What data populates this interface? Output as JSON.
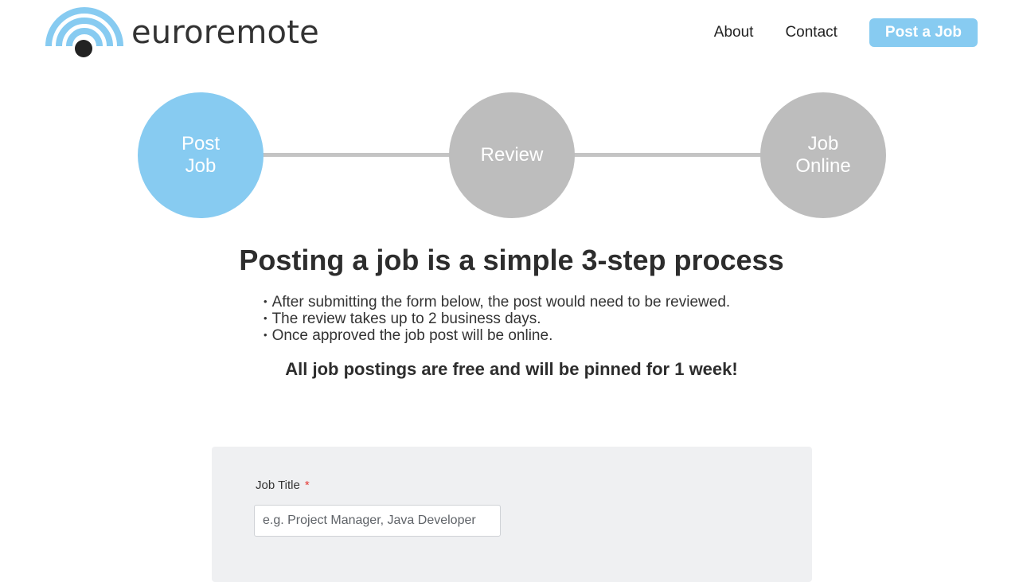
{
  "brand": {
    "name": "euroremote",
    "logo_icon": "wifi-signal-icon",
    "colors": {
      "accent": "#87cbf1",
      "inactive_step": "#bdbdbd",
      "text": "#333333",
      "panel": "#eff0f2",
      "required": "#e53935"
    }
  },
  "nav": {
    "about": "About",
    "contact": "Contact",
    "post_job": "Post a Job"
  },
  "steps": [
    {
      "label": "Post Job",
      "active": true
    },
    {
      "label": "Review",
      "active": false
    },
    {
      "label": "Job Online",
      "active": false
    }
  ],
  "intro": {
    "heading": "Posting a job is a simple 3-step process",
    "bullets": [
      "After submitting the form below, the post would need to be reviewed.",
      "The review takes up to 2 business days.",
      "Once approved the job post will be online."
    ],
    "note": "All job postings are free and will be pinned for 1 week!"
  },
  "form": {
    "job_title": {
      "label": "Job Title",
      "required_mark": "*",
      "value": "",
      "placeholder": "e.g. Project Manager, Java Developer"
    }
  }
}
